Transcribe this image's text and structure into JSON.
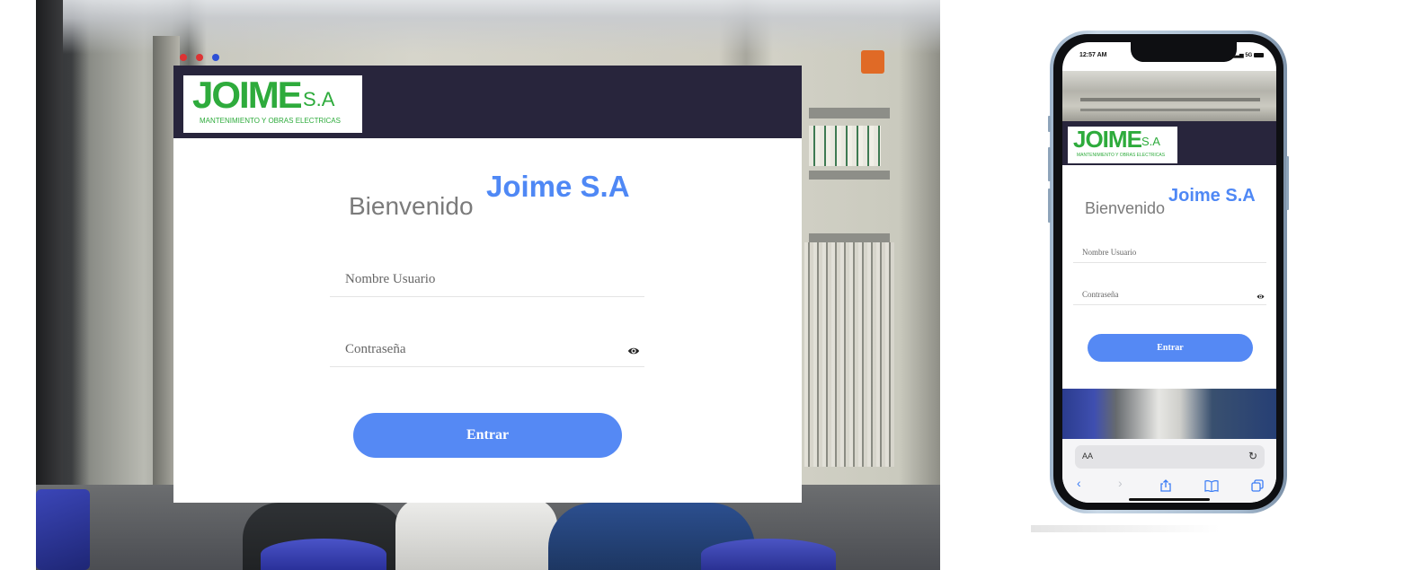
{
  "desktop": {
    "logo": {
      "main": "JOIME",
      "suffix": "S.A",
      "tagline": "MANTENIMIENTO Y OBRAS ELECTRICAS"
    },
    "welcome": "Bienvenido",
    "brand": "Joime S.A",
    "username_placeholder": "Nombre Usuario",
    "password_placeholder": "Contraseña",
    "submit_label": "Entrar",
    "colors": {
      "header": "#28253c",
      "accent": "#5589f4",
      "brand_text": "#4f88f5",
      "logo_green": "#2eab3c"
    }
  },
  "phone": {
    "status": {
      "time": "12:57 AM",
      "right": "5G"
    },
    "logo": {
      "main": "JOIME",
      "suffix": "S.A",
      "tagline": "MANTENIMIENTO Y OBRAS ELECTRICAS"
    },
    "welcome": "Bienvenido",
    "brand": "Joime S.A",
    "username_placeholder": "Nombre Usuario",
    "password_placeholder": "Contraseña",
    "submit_label": "Entrar",
    "browser": {
      "text_size_label": "AA",
      "icons": [
        "reload-icon",
        "back-icon",
        "forward-icon",
        "share-icon",
        "bookmarks-icon",
        "tabs-icon"
      ]
    }
  }
}
